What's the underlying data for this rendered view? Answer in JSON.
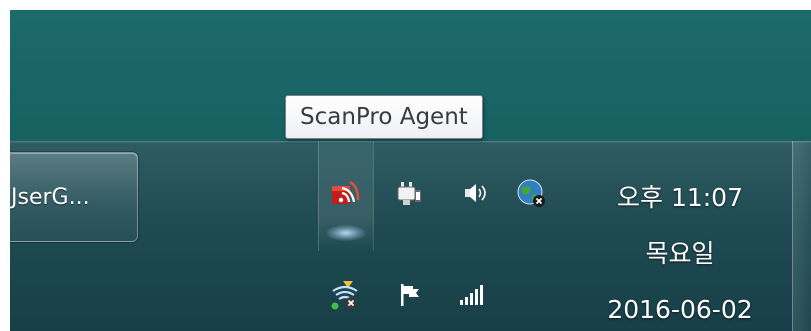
{
  "tooltip": {
    "text": "ScanPro Agent"
  },
  "taskbar": {
    "task_button_label": "JserG..."
  },
  "tray": {
    "icons_row1": [
      "scanpro-agent-icon",
      "power-plug-icon",
      "speaker-volume-icon",
      "network-globe-disconnected-icon"
    ],
    "icons_row2": [
      "wireless-network-disconnected-icon",
      "action-center-flag-icon",
      "signal-strength-icon"
    ]
  },
  "clock": {
    "time": "오후 11:07",
    "weekday": "목요일",
    "date": "2016-06-02"
  },
  "colors": {
    "desktop": "#1d6a6a",
    "taskbar": "#2a555d",
    "tooltip_bg": "#f7f8fb",
    "clock_text": "#ffffff"
  }
}
